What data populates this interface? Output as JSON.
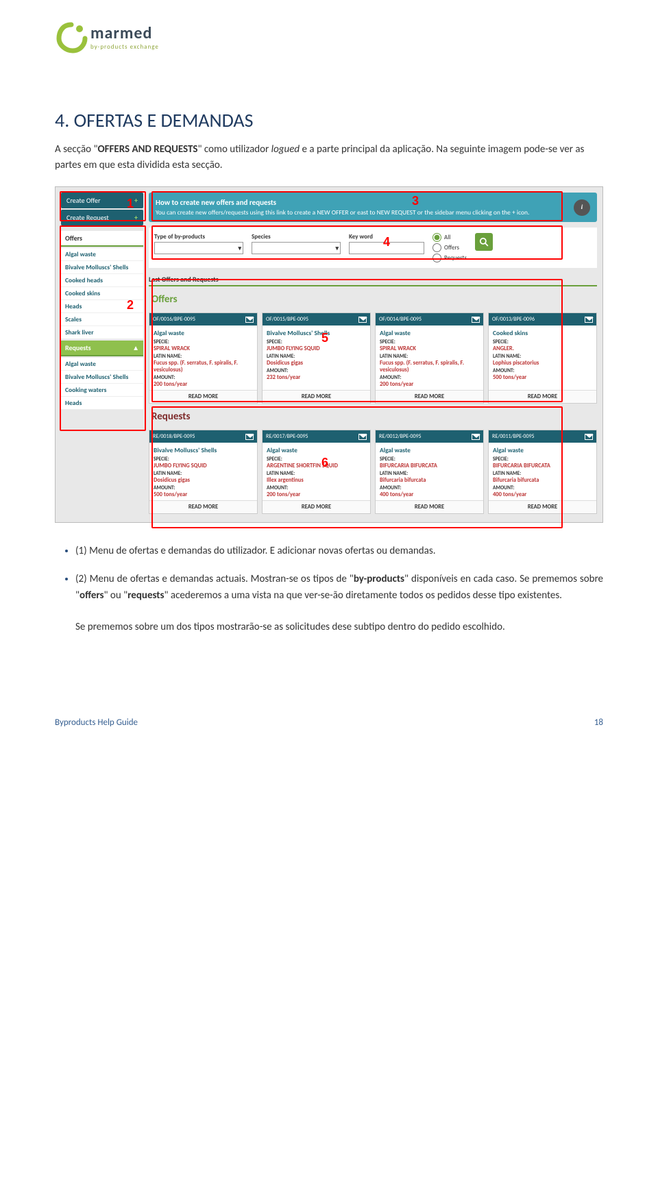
{
  "logo": {
    "text": "marmed",
    "sub": "by-products exchange"
  },
  "heading": "4. OFERTAS E DEMANDAS",
  "intro_pre": "A secção \"",
  "intro_bold": "OFFERS AND REQUESTS",
  "intro_mid": "\" como utilizador ",
  "intro_ital": "logued",
  "intro_post": " e a parte principal da aplicação. Na seguinte imagem pode-se ver as partes em que esta dividida esta secção.",
  "sidebar": {
    "create_offer": "Create Offer",
    "create_request": "Create Request",
    "offers_hdr": "Offers",
    "offers_items": [
      "Algal waste",
      "Bivalve Molluscs' Shells",
      "Cooked heads",
      "Cooked skins",
      "Heads",
      "Scales",
      "Shark liver"
    ],
    "requests_hdr": "Requests",
    "requests_items": [
      "Algal waste",
      "Bivalve Molluscs' Shells",
      "Cooking waters",
      "Heads"
    ]
  },
  "info": {
    "title": "How to create new offers and requests",
    "body": "You can create new offers/requests using this link to create a NEW OFFER or east to NEW REQUEST or the sidebar menu clicking on the + icon."
  },
  "filters": {
    "f1": "Type of by-products",
    "f2": "Species",
    "f3": "Key word",
    "r_all": "All",
    "r_off": "Offers",
    "r_req": "Requests"
  },
  "last_hdr": "Last Offers and Requests",
  "offers_title": "Offers",
  "requests_title": "Requests",
  "labels": {
    "specie": "SPECIE:",
    "latin": "LATIN NAME:",
    "amount": "AMOUNT:",
    "read": "READ MORE"
  },
  "offers": [
    {
      "ref": "OF/0016/BPE-0095",
      "title": "Algal waste",
      "specie": "SPIRAL WRACK",
      "latin": "Fucus spp. (F. serratus, F. spiralis, F. vesiculosus)",
      "amount": "200 tons/year"
    },
    {
      "ref": "OF/0015/BPE-0095",
      "title": "Bivalve Molluscs' Shells",
      "specie": "JUMBO FLYING SQUID",
      "latin": "Dosidicus gigas",
      "amount": "232 tons/year"
    },
    {
      "ref": "OF/0014/BPE-0095",
      "title": "Algal waste",
      "specie": "SPIRAL WRACK",
      "latin": "Fucus spp. (F. serratus, F. spiralis, F. vesiculosus)",
      "amount": "200 tons/year"
    },
    {
      "ref": "OF/0013/BPE-0096",
      "title": "Cooked skins",
      "specie": "ANGLER.",
      "latin": "Lophius piscatorius",
      "amount": "500 tons/year"
    }
  ],
  "requests": [
    {
      "ref": "RE/0018/BPE-0095",
      "title": "Bivalve Molluscs' Shells",
      "specie": "JUMBO FLYING SQUID",
      "latin": "Dosidicus gigas",
      "amount": "500 tons/year"
    },
    {
      "ref": "RE/0017/BPE-0095",
      "title": "Algal waste",
      "specie": "ARGENTINE SHORTFIN SQUID",
      "latin": "Illex argentinus",
      "amount": "200 tons/year"
    },
    {
      "ref": "RE/0012/BPE-0095",
      "title": "Algal waste",
      "specie": "BIFURCARIA BIFURCATA",
      "latin": "Bifurcaria bifurcata",
      "amount": "400 tons/year"
    },
    {
      "ref": "RE/0011/BPE-0095",
      "title": "Algal waste",
      "specie": "BIFURCARIA BIFURCATA",
      "latin": "Bifurcaria bifurcata",
      "amount": "400 tons/year"
    }
  ],
  "bullet1": "(1) Menu de ofertas e demandas do utilizador. E adicionar novas ofertas ou demandas.",
  "bullet2_a": "(2) Menu de ofertas e demandas actuais. Mostran-se os tipos de \"",
  "bullet2_b": "by-products",
  "bullet2_c": "\" disponíveis en cada caso. Se prememos  sobre \"",
  "bullet2_d": "offers",
  "bullet2_e": "\" ou \"",
  "bullet2_f": "requests",
  "bullet2_g": "\" acederemos a uma vista na que ver-se-ão diretamente todos os pedidos desse tipo existentes.",
  "bullet2_h": "Se prememos sobre um dos tipos mostrarão-se as solicitudes dese subtipo dentro do pedido escolhido.",
  "footer_left": "Byproducts Help Guide",
  "footer_right": "18"
}
